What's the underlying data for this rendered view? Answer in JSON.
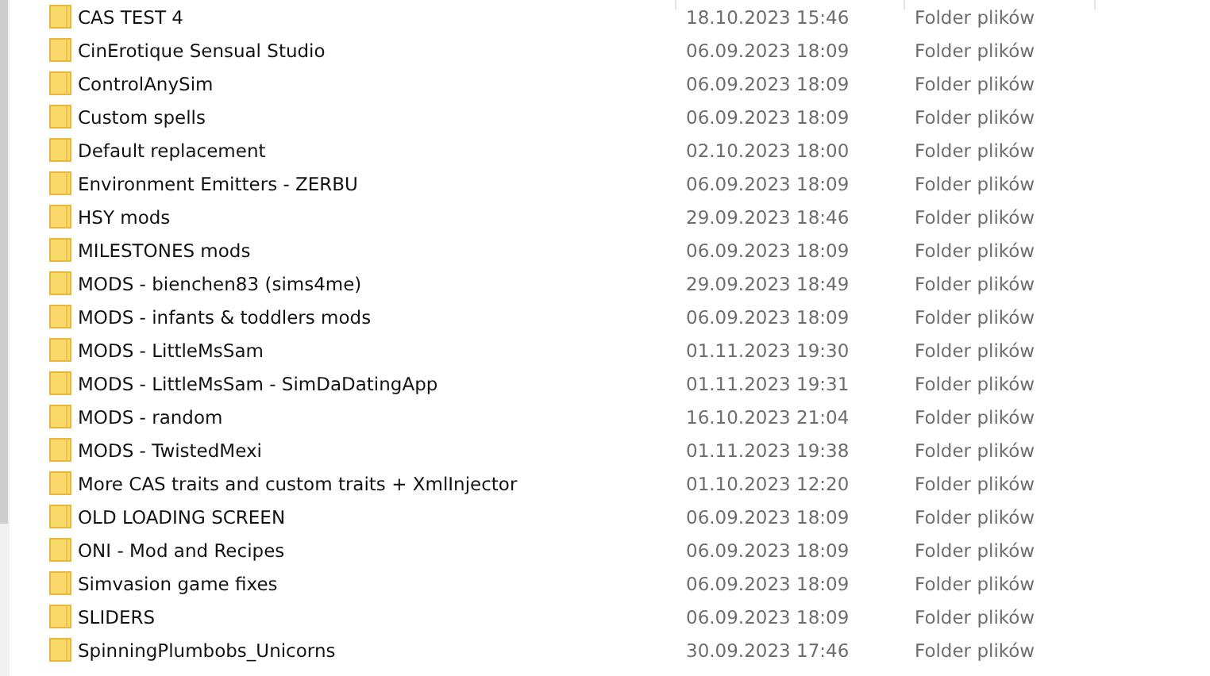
{
  "rows": [
    {
      "name": "CAS TEST 4",
      "modified": "18.10.2023 15:46",
      "type": "Folder plików"
    },
    {
      "name": "CinErotique Sensual Studio",
      "modified": "06.09.2023 18:09",
      "type": "Folder plików"
    },
    {
      "name": "ControlAnySim",
      "modified": "06.09.2023 18:09",
      "type": "Folder plików"
    },
    {
      "name": "Custom spells",
      "modified": "06.09.2023 18:09",
      "type": "Folder plików"
    },
    {
      "name": "Default replacement",
      "modified": "02.10.2023 18:00",
      "type": "Folder plików"
    },
    {
      "name": "Environment Emitters - ZERBU",
      "modified": "06.09.2023 18:09",
      "type": "Folder plików"
    },
    {
      "name": "HSY mods",
      "modified": "29.09.2023 18:46",
      "type": "Folder plików"
    },
    {
      "name": "MILESTONES mods",
      "modified": "06.09.2023 18:09",
      "type": "Folder plików"
    },
    {
      "name": "MODS - bienchen83 (sims4me)",
      "modified": "29.09.2023 18:49",
      "type": "Folder plików"
    },
    {
      "name": "MODS - infants & toddlers mods",
      "modified": "06.09.2023 18:09",
      "type": "Folder plików"
    },
    {
      "name": "MODS - LittleMsSam",
      "modified": "01.11.2023 19:30",
      "type": "Folder plików"
    },
    {
      "name": "MODS - LittleMsSam - SimDaDatingApp",
      "modified": "01.11.2023 19:31",
      "type": "Folder plików"
    },
    {
      "name": "MODS - random",
      "modified": "16.10.2023 21:04",
      "type": "Folder plików"
    },
    {
      "name": "MODS - TwistedMexi",
      "modified": "01.11.2023 19:38",
      "type": "Folder plików"
    },
    {
      "name": "More CAS traits and custom traits + XmlInjector",
      "modified": "01.10.2023 12:20",
      "type": "Folder plików"
    },
    {
      "name": "OLD LOADING SCREEN",
      "modified": "06.09.2023 18:09",
      "type": "Folder plików"
    },
    {
      "name": "ONI - Mod and Recipes",
      "modified": "06.09.2023 18:09",
      "type": "Folder plików"
    },
    {
      "name": "Simvasion game fixes",
      "modified": "06.09.2023 18:09",
      "type": "Folder plików"
    },
    {
      "name": "SLIDERS",
      "modified": "06.09.2023 18:09",
      "type": "Folder plików"
    },
    {
      "name": "SpinningPlumbobs_Unicorns",
      "modified": "30.09.2023 17:46",
      "type": "Folder plików"
    }
  ]
}
